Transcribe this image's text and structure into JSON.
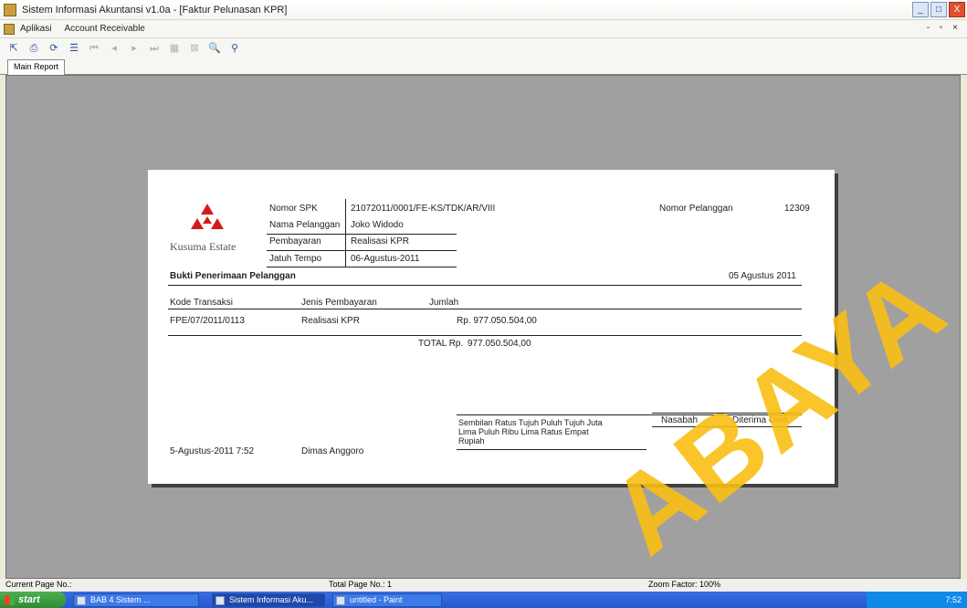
{
  "window": {
    "title": "Sistem Informasi Akuntansi v1.0a - [Faktur Pelunasan KPR]",
    "buttons": {
      "minimize": "_",
      "maximize": "□",
      "close": "X"
    }
  },
  "menubar": {
    "items": [
      "Aplikasi",
      "Account Receivable"
    ],
    "mdi_controls": "- ▫ ×"
  },
  "toolbar": {
    "icons": [
      "export-icon",
      "print-icon",
      "refresh-icon",
      "group-tree-icon",
      "first-page-icon",
      "prev-page-icon",
      "next-page-icon",
      "last-page-icon",
      "goto-page-icon",
      "close-view-icon",
      "search-icon",
      "zoom-icon"
    ]
  },
  "tabs": {
    "main": "Main Report"
  },
  "report": {
    "logo_text": "Kusuma Estate",
    "fields": {
      "nomor_spk_label": "Nomor SPK",
      "nomor_spk_value": "21072011/0001/FE-KS/TDK/AR/VIII",
      "nama_label": "Nama Pelanggan",
      "nama_value": "Joko Widodo",
      "pembayaran_label": "Pembayaran",
      "pembayaran_value": "Realisasi KPR",
      "jatuh_tempo_label": "Jatuh Tempo",
      "jatuh_tempo_value": "06-Agustus-2011",
      "nomor_pelanggan_label": "Nomor Pelanggan",
      "nomor_pelanggan_value": "12309"
    },
    "section_title": "Bukti Penerimaan Pelanggan",
    "date": "05 Agustus 2011",
    "table": {
      "headers": [
        "Kode Transaksi",
        "Jenis Pembayaran",
        "Jumlah"
      ],
      "rows": [
        {
          "kode": "FPE/07/2011/0113",
          "jenis": "Realisasi KPR",
          "jumlah": "Rp. 977.050.504,00"
        }
      ]
    },
    "total_label": "TOTAL Rp.",
    "total_value": "977.050.504,00",
    "terbilang": [
      "Sembilan Ratus Tujuh Puluh Tujuh Juta",
      "Lima Puluh Ribu Lima Ratus Empat",
      "Rupiah"
    ],
    "footer_printed": "5-Agustus-2011 7:52",
    "footer_user": "Dimas Anggoro",
    "signature_labels": [
      "Nasabah",
      "Diterima Oleh"
    ]
  },
  "statusbar": {
    "current_page": "Current Page No.:",
    "total_page": "Total Page No.: 1",
    "zoom": "Zoom Factor: 100%"
  },
  "taskbar": {
    "start_label": "start",
    "tasks": [
      "BAB 4 Sistem ...",
      "Sistem Informasi Aku...",
      "untitled - Paint"
    ],
    "tray_time": "7:52"
  },
  "watermark": "ABAYA"
}
